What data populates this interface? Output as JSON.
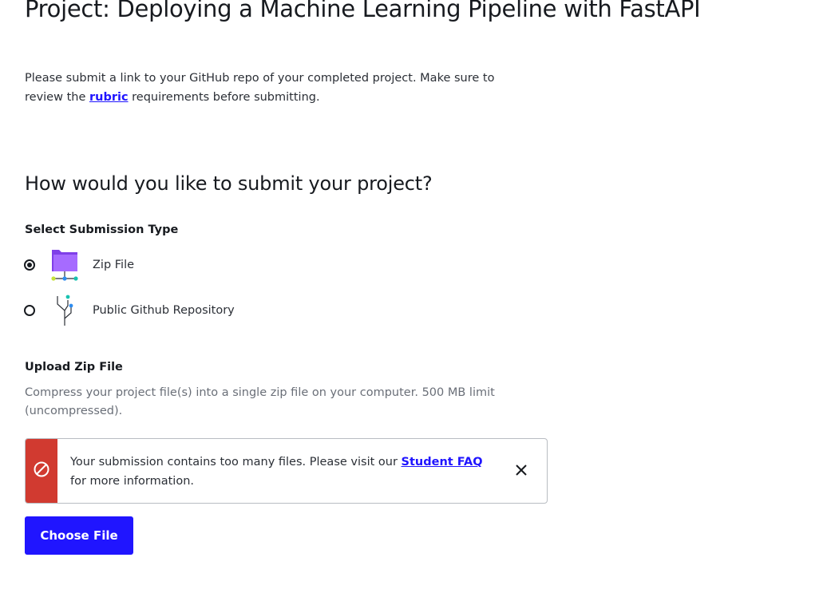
{
  "page": {
    "title": "Project: Deploying a Machine Learning Pipeline with FastAPI",
    "intro": {
      "before_link": "Please submit a link to your GitHub repo of your completed project. Make sure to review the ",
      "link_text": "rubric",
      "after_link": " requirements before submitting."
    }
  },
  "submission": {
    "heading": "How would you like to submit your project?",
    "type_label": "Select Submission Type",
    "options": [
      {
        "label": "Zip File",
        "selected": true,
        "icon": "folder-network-icon"
      },
      {
        "label": "Public Github Repository",
        "selected": false,
        "icon": "git-branch-icon"
      }
    ]
  },
  "upload": {
    "heading": "Upload Zip File",
    "help_text": "Compress your project file(s) into a single zip file on your computer. 500 MB limit (uncompressed).",
    "choose_button": "Choose File"
  },
  "alert": {
    "message_before": "Your submission contains too many files. Please visit our ",
    "link_text": "Student FAQ",
    "message_after": " for more information.",
    "icon": "prohibited-icon",
    "close_icon": "close-icon"
  },
  "colors": {
    "accent": "#2015ff",
    "error": "#d13a30",
    "folder": "#9b5cf6",
    "node_blue": "#2e8cf0",
    "node_teal": "#18c2b0",
    "node_lime": "#c6e23a"
  }
}
